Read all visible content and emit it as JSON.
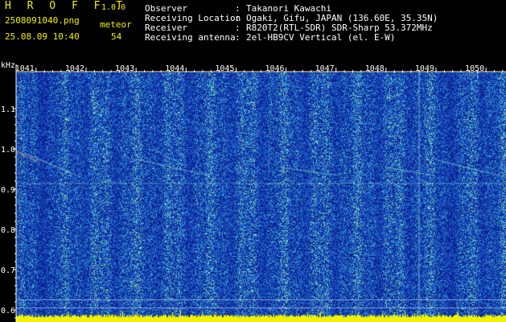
{
  "header": {
    "app_title": "H R O F F T",
    "app_version": "1.0.0",
    "file_name": "2508091040.png",
    "datetime": "25.08.09 10:40",
    "meteor_label": "meteor",
    "meteor_count": "54",
    "info": [
      {
        "label": "Observer",
        "value": "Takanori Kawachi"
      },
      {
        "label": "Receiving Location",
        "value": "Ogaki, Gifu, JAPAN (136.60E, 35.35N)"
      },
      {
        "label": "Receiver",
        "value": "R820T2(RTL-SDR) SDR-Sharp 53.372MHz"
      },
      {
        "label": "Receiving antenna",
        "value": "2el-HB9CV Vertical (el. E-W)"
      }
    ]
  },
  "colors": {
    "header_text": "#f2f200",
    "info_text": "#ffffff",
    "spectrogram_base": "#1c3aa8",
    "echo_line": "#7fe0d0",
    "signal_bars": "#f2f200"
  },
  "chart_data": {
    "type": "heatmap",
    "ylabel": "kHz",
    "x_ticks": [
      "1041",
      "1042",
      "1043",
      "1044",
      "1045",
      "1046",
      "1047",
      "1048",
      "1049",
      "1050"
    ],
    "y_ticks": [
      "1.1",
      "1.0",
      "0.9",
      "0.8",
      "0.7",
      "0.6"
    ],
    "y_range": [
      0.57,
      1.19
    ],
    "x_range": [
      1040.6,
      1050.4
    ],
    "carrier_khz": 0.915,
    "grid": true
  }
}
